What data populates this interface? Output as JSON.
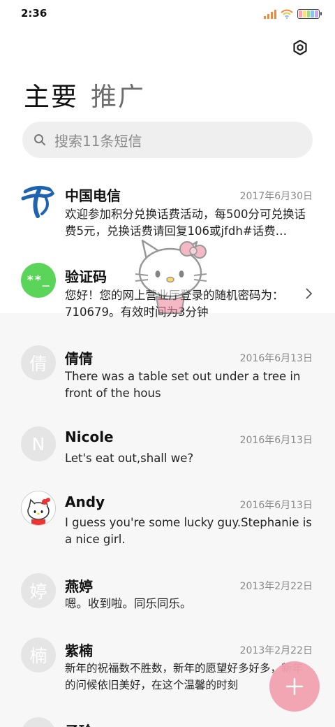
{
  "status_bar": {
    "time": "2:36",
    "signal_color": "#f08a3a",
    "wifi_color": "#f08a3a",
    "battery_colors": [
      "#f9a3b4",
      "#f9e07a",
      "#9be07a",
      "#7ec8f5",
      "#c7a6f0"
    ]
  },
  "header": {
    "tabs": [
      {
        "label": "主要",
        "active": true
      },
      {
        "label": "推广",
        "active": false
      }
    ],
    "settings_icon": "settings-hexagon-icon"
  },
  "search": {
    "placeholder": "搜索11条短信",
    "icon": "search-icon"
  },
  "messages": [
    {
      "name": "中国电信",
      "date": "2017年6月30日",
      "preview": "欢迎参加积分兑换话费活动，每500分可兑换话费5元，兑换话费请回复106或jfdh#话费…",
      "avatar_type": "china-telecom-logo"
    },
    {
      "name": "验证码",
      "date": "",
      "preview": "您好！您的网上营业厅登录的随机密码为：710679。有效时间为3分钟",
      "avatar_text": "**_",
      "avatar_color": "#5bd45a"
    },
    {
      "name": "倩倩",
      "date": "2016年6月13日",
      "preview": "There was a table set out under a tree in front of the hous",
      "avatar_text": "倩"
    },
    {
      "name": "Nicole",
      "date": "2016年6月13日",
      "preview": "Let's eat out,shall we?",
      "avatar_text": "N"
    },
    {
      "name": "Andy",
      "date": "2016年6月13日",
      "preview": "I guess you're some lucky guy.Stephanie is a nice girl.",
      "avatar_type": "hello-kitty-photo"
    },
    {
      "name": "燕婷",
      "date": "2013年2月22日",
      "preview": "嗯。收到啦。同乐同乐。",
      "avatar_text": "婷"
    },
    {
      "name": "紫楠",
      "date": "2013年2月22日",
      "preview": "新年的祝福数不胜数，新年的愿望好多好多，新年的问候依旧美好，在这个温馨的时刻",
      "avatar_text": "楠"
    },
    {
      "name": "子玲",
      "date": "",
      "preview": "",
      "avatar_text": ""
    }
  ],
  "fab": {
    "icon": "plus-icon",
    "color": "#f2a2b1"
  },
  "overlay": {
    "icon": "hello-kitty-icon"
  }
}
